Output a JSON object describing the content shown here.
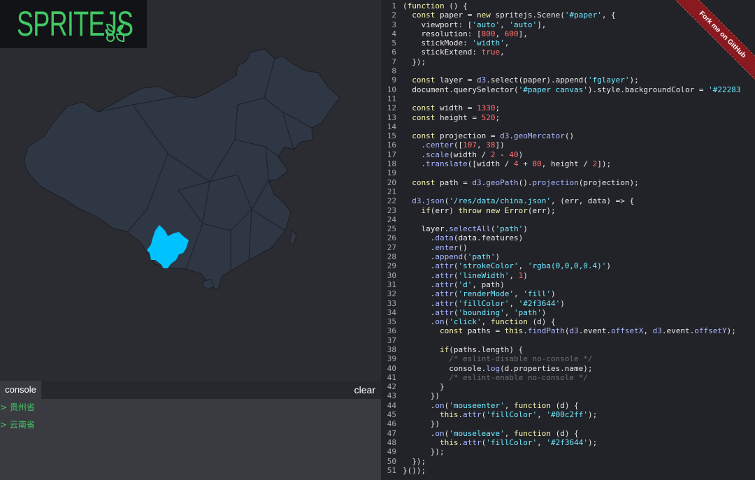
{
  "logo": {
    "text": "SPRITEJS"
  },
  "map": {
    "background_color": "#2b2c32",
    "province_fill": "#2f3644",
    "province_stroke": "rgba(0,0,0,0.4)",
    "highlight_fill": "#00c2ff",
    "highlighted_region": "云南省"
  },
  "console": {
    "tab_label": "console",
    "clear_label": "clear",
    "prompt": ">",
    "lines": [
      "贵州省",
      "云南省"
    ]
  },
  "ribbon": {
    "label": "Fork me on GitHub",
    "color": "#8a1a1f"
  },
  "code": {
    "lines": [
      [
        [
          "(",
          "p"
        ],
        [
          "function",
          "kw"
        ],
        [
          " () {",
          "p"
        ]
      ],
      [
        [
          "  ",
          "p"
        ],
        [
          "const",
          "kw"
        ],
        [
          " paper = ",
          "p"
        ],
        [
          "new",
          "kw"
        ],
        [
          " spritejs.Scene(",
          "p"
        ],
        [
          "'#paper'",
          "st"
        ],
        [
          ", {",
          "p"
        ]
      ],
      [
        [
          "    viewport: [",
          "p"
        ],
        [
          "'auto'",
          "st"
        ],
        [
          ", ",
          "p"
        ],
        [
          "'auto'",
          "st"
        ],
        [
          "],",
          "p"
        ]
      ],
      [
        [
          "    resolution: [",
          "p"
        ],
        [
          "800",
          "nu"
        ],
        [
          ", ",
          "p"
        ],
        [
          "600",
          "nu"
        ],
        [
          "],",
          "p"
        ]
      ],
      [
        [
          "    stickMode: ",
          "p"
        ],
        [
          "'width'",
          "st"
        ],
        [
          ",",
          "p"
        ]
      ],
      [
        [
          "    stickExtend: ",
          "p"
        ],
        [
          "true",
          "nu"
        ],
        [
          ",",
          "p"
        ]
      ],
      [
        [
          "  });",
          "p"
        ]
      ],
      [
        [
          "",
          "p"
        ]
      ],
      [
        [
          "  ",
          "p"
        ],
        [
          "const",
          "kw"
        ],
        [
          " layer = ",
          "p"
        ],
        [
          "d3",
          "fn"
        ],
        [
          ".select(paper).append(",
          "p"
        ],
        [
          "'fglayer'",
          "st"
        ],
        [
          ");",
          "p"
        ]
      ],
      [
        [
          "  document.querySelector(",
          "p"
        ],
        [
          "'#paper canvas'",
          "st"
        ],
        [
          ").style.backgroundColor = ",
          "p"
        ],
        [
          "'#22283",
          "st"
        ]
      ],
      [
        [
          "",
          "p"
        ]
      ],
      [
        [
          "  ",
          "p"
        ],
        [
          "const",
          "kw"
        ],
        [
          " width = ",
          "p"
        ],
        [
          "1330",
          "nu"
        ],
        [
          ";",
          "p"
        ]
      ],
      [
        [
          "  ",
          "p"
        ],
        [
          "const",
          "kw"
        ],
        [
          " height = ",
          "p"
        ],
        [
          "520",
          "nu"
        ],
        [
          ";",
          "p"
        ]
      ],
      [
        [
          "",
          "p"
        ]
      ],
      [
        [
          "  ",
          "p"
        ],
        [
          "const",
          "kw"
        ],
        [
          " projection = ",
          "p"
        ],
        [
          "d3",
          "fn"
        ],
        [
          ".",
          "p"
        ],
        [
          "geoMercator",
          "fn"
        ],
        [
          "()",
          "p"
        ]
      ],
      [
        [
          "    .",
          "p"
        ],
        [
          "center",
          "fn"
        ],
        [
          "([",
          "p"
        ],
        [
          "107",
          "nu"
        ],
        [
          ", ",
          "p"
        ],
        [
          "38",
          "nu"
        ],
        [
          "])",
          "p"
        ]
      ],
      [
        [
          "    .",
          "p"
        ],
        [
          "scale",
          "fn"
        ],
        [
          "(width / ",
          "p"
        ],
        [
          "2",
          "nu"
        ],
        [
          " - ",
          "p"
        ],
        [
          "40",
          "nu"
        ],
        [
          ")",
          "p"
        ]
      ],
      [
        [
          "    .",
          "p"
        ],
        [
          "translate",
          "fn"
        ],
        [
          "([width / ",
          "p"
        ],
        [
          "4",
          "nu"
        ],
        [
          " + ",
          "p"
        ],
        [
          "80",
          "nu"
        ],
        [
          ", height / ",
          "p"
        ],
        [
          "2",
          "nu"
        ],
        [
          "]);",
          "p"
        ]
      ],
      [
        [
          "",
          "p"
        ]
      ],
      [
        [
          "  ",
          "p"
        ],
        [
          "const",
          "kw"
        ],
        [
          " path = ",
          "p"
        ],
        [
          "d3",
          "fn"
        ],
        [
          ".",
          "p"
        ],
        [
          "geoPath",
          "fn"
        ],
        [
          "().",
          "p"
        ],
        [
          "projection",
          "fn"
        ],
        [
          "(projection);",
          "p"
        ]
      ],
      [
        [
          "",
          "p"
        ]
      ],
      [
        [
          "  ",
          "p"
        ],
        [
          "d3",
          "fn"
        ],
        [
          ".",
          "p"
        ],
        [
          "json",
          "fn"
        ],
        [
          "(",
          "p"
        ],
        [
          "'/res/data/china.json'",
          "st"
        ],
        [
          ", (err, data) => {",
          "p"
        ]
      ],
      [
        [
          "    ",
          "p"
        ],
        [
          "if",
          "kw"
        ],
        [
          "(err) ",
          "p"
        ],
        [
          "throw",
          "kw"
        ],
        [
          " ",
          "p"
        ],
        [
          "new",
          "kw"
        ],
        [
          " ",
          "p"
        ],
        [
          "Error",
          "kw"
        ],
        [
          "(err);",
          "p"
        ]
      ],
      [
        [
          "",
          "p"
        ]
      ],
      [
        [
          "    layer.",
          "p"
        ],
        [
          "selectAll",
          "fn"
        ],
        [
          "(",
          "p"
        ],
        [
          "'path'",
          "st"
        ],
        [
          ")",
          "p"
        ]
      ],
      [
        [
          "      .",
          "p"
        ],
        [
          "data",
          "fn"
        ],
        [
          "(data.features)",
          "p"
        ]
      ],
      [
        [
          "      .",
          "p"
        ],
        [
          "enter",
          "fn"
        ],
        [
          "()",
          "p"
        ]
      ],
      [
        [
          "      .",
          "p"
        ],
        [
          "append",
          "fn"
        ],
        [
          "(",
          "p"
        ],
        [
          "'path'",
          "st"
        ],
        [
          ")",
          "p"
        ]
      ],
      [
        [
          "      .",
          "p"
        ],
        [
          "attr",
          "fn"
        ],
        [
          "(",
          "p"
        ],
        [
          "'strokeColor'",
          "st"
        ],
        [
          ", ",
          "p"
        ],
        [
          "'rgba(0,0,0,0.4)'",
          "st"
        ],
        [
          ")",
          "p"
        ]
      ],
      [
        [
          "      .",
          "p"
        ],
        [
          "attr",
          "fn"
        ],
        [
          "(",
          "p"
        ],
        [
          "'lineWidth'",
          "st"
        ],
        [
          ", ",
          "p"
        ],
        [
          "1",
          "nu"
        ],
        [
          ")",
          "p"
        ]
      ],
      [
        [
          "      .",
          "p"
        ],
        [
          "attr",
          "fn"
        ],
        [
          "(",
          "p"
        ],
        [
          "'d'",
          "st"
        ],
        [
          ", path)",
          "p"
        ]
      ],
      [
        [
          "      .",
          "p"
        ],
        [
          "attr",
          "fn"
        ],
        [
          "(",
          "p"
        ],
        [
          "'renderMode'",
          "st"
        ],
        [
          ", ",
          "p"
        ],
        [
          "'fill'",
          "st"
        ],
        [
          ")",
          "p"
        ]
      ],
      [
        [
          "      .",
          "p"
        ],
        [
          "attr",
          "fn"
        ],
        [
          "(",
          "p"
        ],
        [
          "'fillColor'",
          "st"
        ],
        [
          ", ",
          "p"
        ],
        [
          "'#2f3644'",
          "st"
        ],
        [
          ")",
          "p"
        ]
      ],
      [
        [
          "      .",
          "p"
        ],
        [
          "attr",
          "fn"
        ],
        [
          "(",
          "p"
        ],
        [
          "'bounding'",
          "st"
        ],
        [
          ", ",
          "p"
        ],
        [
          "'path'",
          "st"
        ],
        [
          ")",
          "p"
        ]
      ],
      [
        [
          "      .",
          "p"
        ],
        [
          "on",
          "fn"
        ],
        [
          "(",
          "p"
        ],
        [
          "'click'",
          "st"
        ],
        [
          ", ",
          "p"
        ],
        [
          "function",
          "kw"
        ],
        [
          " (d) {",
          "p"
        ]
      ],
      [
        [
          "        ",
          "p"
        ],
        [
          "const",
          "kw"
        ],
        [
          " paths = ",
          "p"
        ],
        [
          "this",
          "kw"
        ],
        [
          ".",
          "p"
        ],
        [
          "findPath",
          "fn"
        ],
        [
          "(",
          "p"
        ],
        [
          "d3",
          "fn"
        ],
        [
          ".event.",
          "p"
        ],
        [
          "offsetX",
          "fn"
        ],
        [
          ", ",
          "p"
        ],
        [
          "d3",
          "fn"
        ],
        [
          ".event.",
          "p"
        ],
        [
          "offsetY",
          "fn"
        ],
        [
          ");",
          "p"
        ]
      ],
      [
        [
          "",
          "p"
        ]
      ],
      [
        [
          "        ",
          "p"
        ],
        [
          "if",
          "kw"
        ],
        [
          "(paths.length) {",
          "p"
        ]
      ],
      [
        [
          "          ",
          "p"
        ],
        [
          "/* eslint-disable no-console */",
          "cm"
        ]
      ],
      [
        [
          "          console.",
          "p"
        ],
        [
          "log",
          "fn"
        ],
        [
          "(d.properties.name);",
          "p"
        ]
      ],
      [
        [
          "          ",
          "p"
        ],
        [
          "/* eslint-enable no-console */",
          "cm"
        ]
      ],
      [
        [
          "        }",
          "p"
        ]
      ],
      [
        [
          "      })",
          "p"
        ]
      ],
      [
        [
          "      .",
          "p"
        ],
        [
          "on",
          "fn"
        ],
        [
          "(",
          "p"
        ],
        [
          "'mouseenter'",
          "st"
        ],
        [
          ", ",
          "p"
        ],
        [
          "function",
          "kw"
        ],
        [
          " (d) {",
          "p"
        ]
      ],
      [
        [
          "        ",
          "p"
        ],
        [
          "this",
          "kw"
        ],
        [
          ".",
          "p"
        ],
        [
          "attr",
          "fn"
        ],
        [
          "(",
          "p"
        ],
        [
          "'fillColor'",
          "st"
        ],
        [
          ", ",
          "p"
        ],
        [
          "'#00c2ff'",
          "st"
        ],
        [
          ");",
          "p"
        ]
      ],
      [
        [
          "      })",
          "p"
        ]
      ],
      [
        [
          "      .",
          "p"
        ],
        [
          "on",
          "fn"
        ],
        [
          "(",
          "p"
        ],
        [
          "'mouseleave'",
          "st"
        ],
        [
          ", ",
          "p"
        ],
        [
          "function",
          "kw"
        ],
        [
          " (d) {",
          "p"
        ]
      ],
      [
        [
          "        ",
          "p"
        ],
        [
          "this",
          "kw"
        ],
        [
          ".",
          "p"
        ],
        [
          "attr",
          "fn"
        ],
        [
          "(",
          "p"
        ],
        [
          "'fillColor'",
          "st"
        ],
        [
          ", ",
          "p"
        ],
        [
          "'#2f3644'",
          "st"
        ],
        [
          ");",
          "p"
        ]
      ],
      [
        [
          "      });",
          "p"
        ]
      ],
      [
        [
          "  });",
          "p"
        ]
      ],
      [
        [
          "}());",
          "p"
        ]
      ]
    ]
  }
}
